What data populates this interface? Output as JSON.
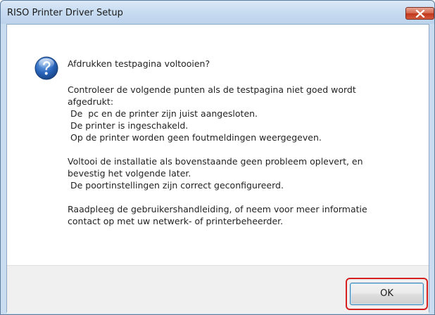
{
  "window": {
    "title": "RISO Printer Driver Setup",
    "close_icon": "close-icon"
  },
  "dialog": {
    "icon": "question-icon",
    "question": "Afdrukken testpagina voltooien?",
    "check_intro_1": "Controleer de volgende punten als de testpagina niet goed wordt",
    "check_intro_2": "afgedrukt:",
    "check_items": [
      " De  pc en de printer zijn juist aangesloten.",
      " De printer is ingeschakeld.",
      " Op de printer worden geen foutmeldingen weergegeven."
    ],
    "install_1": "Voltooi de installatie als bovenstaande geen probleem oplevert, en",
    "install_2": "bevestig het volgende later.",
    "install_item": " De poortinstellingen zijn correct geconfigureerd.",
    "consult_1": "Raadpleeg de gebruikershandleiding, of neem voor meer informatie",
    "consult_2": "contact op met uw netwerk- of printerbeheerder."
  },
  "footer": {
    "ok_label": "OK"
  },
  "colors": {
    "highlight": "#d62020",
    "close_button": "#c0361b",
    "title_bar": "#c7dbf1"
  }
}
